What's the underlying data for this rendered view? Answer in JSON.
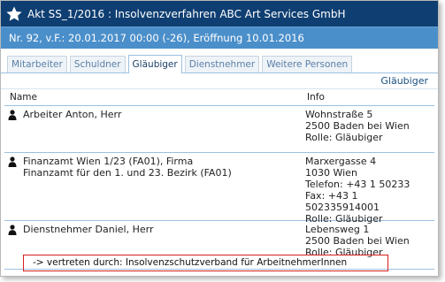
{
  "window": {
    "title": "Akt SS_1/2016 : Insolvenzverfahren ABC Art Services GmbH",
    "subtitle": "Nr. 92, v.F.: 20.01.2017 00:00 (-26), Eröffnung 10.01.2016",
    "icon": "star-icon"
  },
  "tabs": [
    {
      "label": "Mitarbeiter"
    },
    {
      "label": "Schuldner"
    },
    {
      "label": "Gläubiger"
    },
    {
      "label": "Dienstnehmer"
    },
    {
      "label": "Weitere Personen"
    }
  ],
  "active_tab": "Gläubiger",
  "section_title": "Gläubiger",
  "columns": {
    "name": "Name",
    "info": "Info"
  },
  "rows": [
    {
      "name_lines": [
        "Arbeiter Anton, Herr"
      ],
      "info_lines": [
        "Wohnstraße 5",
        "2500 Baden bei Wien",
        "Rolle: Gläubiger"
      ]
    },
    {
      "name_lines": [
        "Finanzamt Wien 1/23 (FA01), Firma",
        "Finanzamt für den 1. und 23. Bezirk (FA01)"
      ],
      "info_lines": [
        "Marxergasse 4",
        "1030 Wien",
        "Telefon: +43 1 50233",
        "Fax: +43 1 502335914001",
        "Rolle: Gläubiger"
      ]
    },
    {
      "name_lines": [
        "Dienstnehmer Daniel, Herr"
      ],
      "info_lines": [
        "Lebensweg 1",
        "2500 Baden bei Wien",
        "Rolle: Gläubiger"
      ]
    }
  ],
  "representation": "-> vertreten durch: Insolvenzschutzverband für ArbeitnehmerInnen",
  "colors": {
    "titlebar": "#0f3f72",
    "subbar": "#4b8fca",
    "highlight_border": "#d62020"
  }
}
